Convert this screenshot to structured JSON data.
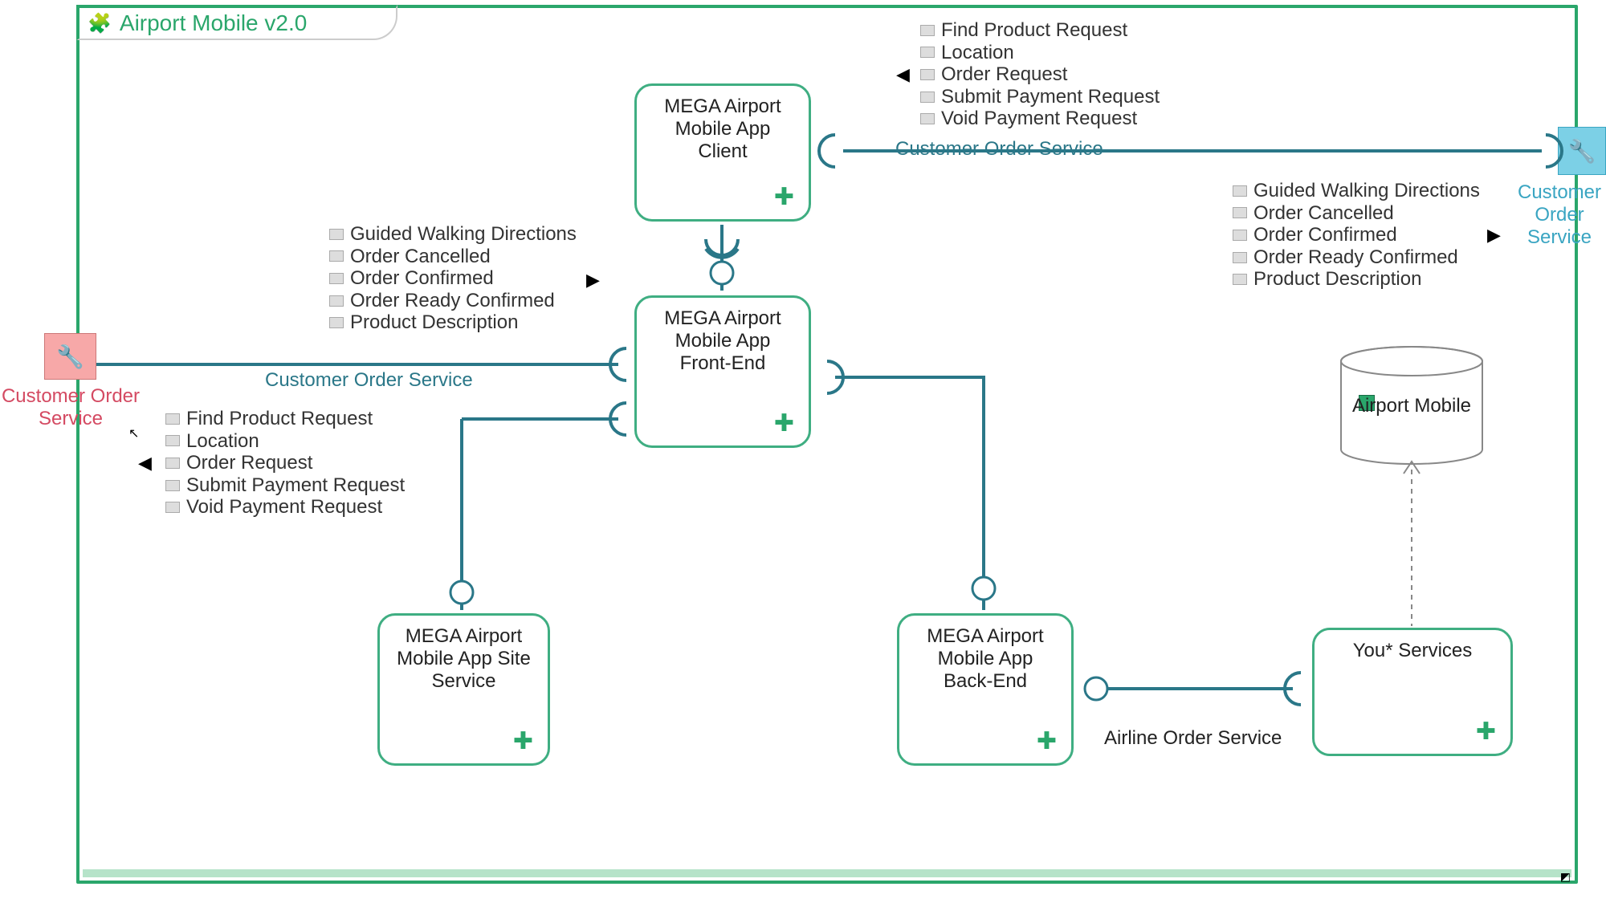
{
  "title": "Airport Mobile v2.0",
  "components": {
    "client": {
      "label": "MEGA Airport Mobile App Client"
    },
    "frontend": {
      "label": "MEGA Airport Mobile App Front-End"
    },
    "site": {
      "label": "MEGA Airport Mobile App Site Service"
    },
    "backend": {
      "label": "MEGA Airport Mobile App Back-End"
    },
    "youx": {
      "label": "You* Services"
    }
  },
  "datastore": {
    "label": "Airport Mobile"
  },
  "externals": {
    "left": {
      "label": "Customer Order Service"
    },
    "right": {
      "label": "Customer Order Service"
    }
  },
  "connectors": {
    "top_right": "Customer Order Service",
    "mid_left": "Customer Order Service",
    "airline": "Airline Order Service"
  },
  "msg_groups": {
    "requests_top": [
      "Find Product Request",
      "Location",
      "Order Request",
      "Submit Payment Request",
      "Void Payment Request"
    ],
    "responses_left": [
      "Guided Walking Directions",
      "Order Cancelled",
      "Order Confirmed",
      "Order Ready Confirmed",
      "Product Description"
    ],
    "requests_left": [
      "Find Product Request",
      "Location",
      "Order Request",
      "Submit Payment Request",
      "Void Payment Request"
    ],
    "responses_right": [
      "Guided Walking Directions",
      "Order Cancelled",
      "Order Confirmed",
      "Order Ready Confirmed",
      "Product Description"
    ]
  }
}
